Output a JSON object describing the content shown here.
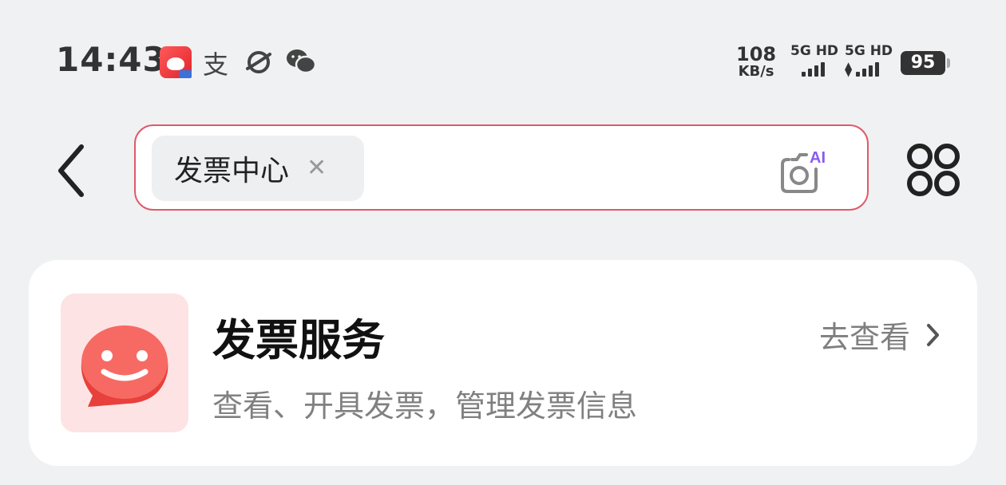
{
  "status_bar": {
    "time": "14:43",
    "alipay_glyph": "支",
    "net_speed_value": "108",
    "net_speed_unit": "KB/s",
    "sim1_label": "5G HD",
    "sim2_label": "5G HD",
    "battery_level": "95"
  },
  "header": {
    "search_chip_label": "发票中心",
    "ai_badge": "AI"
  },
  "service_card": {
    "title": "发票服务",
    "description": "查看、开具发票，管理发票信息",
    "link_label": "去查看"
  },
  "icons": {
    "back": "chevron-left-icon",
    "chip_close": "close-icon",
    "camera": "ai-camera-icon",
    "more": "four-circles-icon",
    "service": "chat-face-icon",
    "link_arrow": "chevron-right-icon"
  },
  "colors": {
    "accent": "#e05a6a",
    "service_icon_bg": "#fde3e4",
    "service_icon": "#f0524f",
    "ai_badge": "#8a5cf0"
  }
}
